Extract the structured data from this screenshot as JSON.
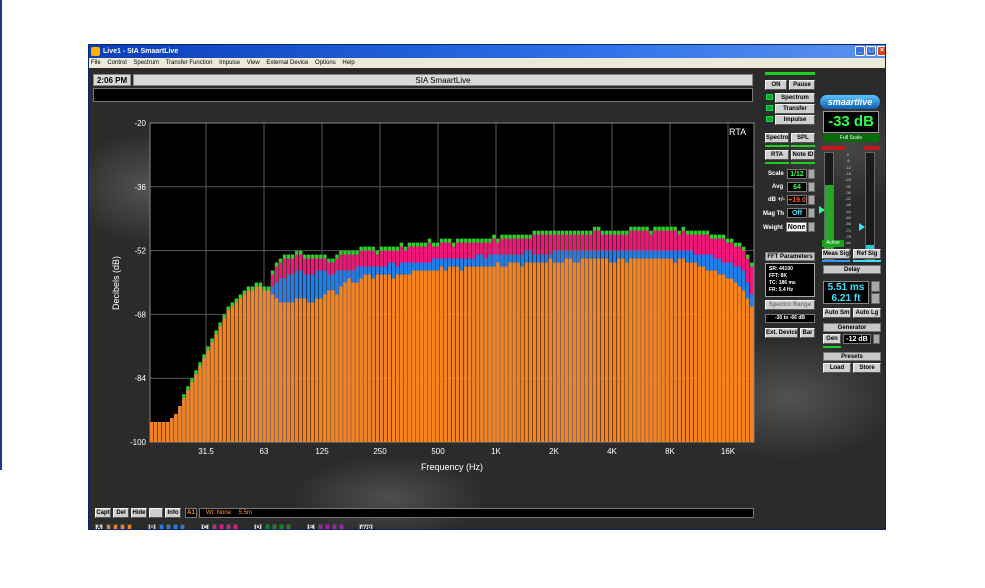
{
  "window": {
    "title": "Live1 - SIA SmaartLive"
  },
  "menu": [
    "File",
    "Control",
    "Spectrum",
    "Transfer Function",
    "Impulse",
    "View",
    "External Device",
    "Options",
    "Help"
  ],
  "header": {
    "clock": "2:06 PM",
    "app_title": "SIA SmaartLive"
  },
  "right_panel": {
    "on": "ON",
    "pause": "Pause",
    "mode_spectrum": "Spectrum",
    "mode_transfer": "Transfer",
    "mode_impulse": "Impulse",
    "spectro": "Spectro",
    "spl": "SPL",
    "rta": "RTA",
    "note_id": "Note ID",
    "scale_label": "Scale",
    "scale_value": "1/12",
    "avg_label": "Avg",
    "avg_value": "64",
    "db_label": "dB +/-",
    "db_value": "+19.0",
    "magth_label": "Mag Th",
    "magth_value": "Off",
    "weight_label": "Weight",
    "weight_value": "None",
    "fft_header": "FFT Parameters",
    "fft_sr": "SR: 44100",
    "fft_fft": "FFT: 8K",
    "fft_tc": "TC: 186 ms",
    "fft_fr": "FR: 5.4 Hz",
    "spectro_range": "Spectro Range",
    "spectro_range_value": "-30 to -66 dB",
    "ext_device": "Ext. Device",
    "bar": "Bar",
    "logo": "smaartlive",
    "level_readout": "-33 dB",
    "full_scale": "Full Scale",
    "active": "Active",
    "meas_sig": "Meas Sig",
    "ref_sig": "Ref Sig",
    "delay_header": "Delay",
    "delay_ms": "5.51 ms",
    "delay_ft": "6.21 ft",
    "auto_sm": "Auto Sm",
    "auto_lg": "Auto Lg",
    "generator_header": "Generator",
    "gen": "Gen",
    "gen_level": "-12 dB",
    "presets_header": "Presets",
    "load": "Load",
    "store": "Store",
    "meter_scale": [
      "0",
      "-6",
      "-12",
      "-18",
      "-24",
      "-30",
      "-36",
      "-42",
      "-48",
      "-54",
      "-60",
      "-66",
      "-72",
      "-78",
      "-84",
      "-90",
      "-96"
    ]
  },
  "bottom": {
    "capt": "Capt",
    "del": "Del",
    "hide": "Hide",
    "info": "Info",
    "status_a1": "A1",
    "status_wt": "Wt: None",
    "status_delay": "5.5m",
    "sets": [
      "A",
      "B",
      "C",
      "D",
      "E"
    ],
    "avg": "avg"
  },
  "colors": {
    "orange": "#f5841f",
    "blue": "#1f7fe8",
    "magenta": "#f0157a",
    "green": "#2bd12b"
  },
  "chart_data": {
    "type": "bar",
    "label": "RTA",
    "xlabel": "Frequency (Hz)",
    "ylabel": "Decibels (dB)",
    "ylim": [
      -100,
      -20
    ],
    "yticks": [
      "-20",
      "-36",
      "-52",
      "-68",
      "-84",
      "-100"
    ],
    "xticks": [
      "31.5",
      "63",
      "125",
      "250",
      "500",
      "1K",
      "2K",
      "4K",
      "8K",
      "16K"
    ],
    "grid": true,
    "bands": 150,
    "series": [
      {
        "name": "orange",
        "values": [
          -95,
          -95,
          -95,
          -95,
          -95,
          -94,
          -93,
          -91,
          -89,
          -87,
          -85,
          -83,
          -81,
          -79,
          -77,
          -75,
          -73,
          -71,
          -69,
          -67,
          -66,
          -65,
          -64,
          -63,
          -62,
          -62,
          -61,
          -61,
          -62,
          -62,
          -63,
          -64,
          -65,
          -65,
          -65,
          -65,
          -64,
          -64,
          -64,
          -65,
          -65,
          -64,
          -64,
          -63,
          -62,
          -62,
          -63,
          -61,
          -60,
          -59,
          -60,
          -60,
          -59,
          -58,
          -58,
          -59,
          -58,
          -58,
          -58,
          -58,
          -59,
          -58,
          -58,
          -58,
          -58,
          -57,
          -57,
          -57,
          -57,
          -57,
          -57,
          -57,
          -56,
          -57,
          -56,
          -56,
          -56,
          -57,
          -56,
          -56,
          -56,
          -56,
          -56,
          -56,
          -56,
          -56,
          -55,
          -56,
          -56,
          -55,
          -55,
          -55,
          -56,
          -55,
          -55,
          -55,
          -55,
          -55,
          -55,
          -54,
          -55,
          -55,
          -55,
          -54,
          -54,
          -55,
          -55,
          -54,
          -54,
          -54,
          -54,
          -54,
          -54,
          -54,
          -55,
          -55,
          -54,
          -54,
          -55,
          -54,
          -54,
          -54,
          -54,
          -54,
          -54,
          -54,
          -54,
          -54,
          -54,
          -54,
          -55,
          -54,
          -54,
          -55,
          -55,
          -55,
          -56,
          -56,
          -57,
          -57,
          -57,
          -58,
          -58,
          -59,
          -59,
          -60,
          -61,
          -62,
          -64,
          -66
        ]
      },
      {
        "name": "blue",
        "values": [
          -95,
          -95,
          -95,
          -95,
          -95,
          -94,
          -93,
          -91,
          -89,
          -87,
          -85,
          -83,
          -81,
          -79,
          -77,
          -75,
          -73,
          -71,
          -69,
          -67,
          -66,
          -65,
          -64,
          -63,
          -62,
          -62,
          -61,
          -61,
          -62,
          -62,
          -61,
          -60,
          -59,
          -59,
          -58,
          -58,
          -57,
          -57,
          -58,
          -58,
          -58,
          -57,
          -57,
          -57,
          -58,
          -58,
          -57,
          -57,
          -57,
          -57,
          -57,
          -56,
          -56,
          -56,
          -56,
          -56,
          -56,
          -56,
          -56,
          -55,
          -55,
          -56,
          -55,
          -55,
          -55,
          -55,
          -55,
          -55,
          -55,
          -55,
          -54,
          -54,
          -54,
          -54,
          -54,
          -54,
          -54,
          -54,
          -54,
          -54,
          -54,
          -53,
          -53,
          -54,
          -53,
          -53,
          -53,
          -53,
          -53,
          -53,
          -53,
          -53,
          -53,
          -52,
          -52,
          -53,
          -53,
          -53,
          -53,
          -53,
          -52,
          -52,
          -52,
          -52,
          -52,
          -52,
          -52,
          -52,
          -52,
          -52,
          -52,
          -52,
          -52,
          -52,
          -52,
          -52,
          -52,
          -52,
          -52,
          -52,
          -52,
          -52,
          -52,
          -52,
          -52,
          -52,
          -52,
          -52,
          -52,
          -52,
          -52,
          -52,
          -52,
          -52,
          -52,
          -53,
          -53,
          -53,
          -53,
          -53,
          -54,
          -54,
          -55,
          -55,
          -55,
          -56,
          -56,
          -57,
          -60,
          -63
        ]
      },
      {
        "name": "magenta",
        "values": [
          -95,
          -95,
          -95,
          -95,
          -95,
          -94,
          -93,
          -91,
          -89,
          -87,
          -85,
          -83,
          -81,
          -79,
          -77,
          -75,
          -73,
          -71,
          -69,
          -67,
          -66,
          -65,
          -64,
          -63,
          -62,
          -62,
          -61,
          -61,
          -62,
          -62,
          -58,
          -56,
          -55,
          -54,
          -54,
          -54,
          -53,
          -53,
          -54,
          -54,
          -54,
          -54,
          -54,
          -54,
          -55,
          -55,
          -54,
          -53,
          -53,
          -53,
          -53,
          -53,
          -52,
          -52,
          -52,
          -52,
          -53,
          -52,
          -52,
          -52,
          -52,
          -52,
          -51,
          -52,
          -51,
          -51,
          -51,
          -51,
          -51,
          -50,
          -51,
          -51,
          -50,
          -50,
          -50,
          -51,
          -50,
          -50,
          -50,
          -50,
          -50,
          -50,
          -50,
          -50,
          -50,
          -49,
          -50,
          -49,
          -49,
          -49,
          -49,
          -49,
          -49,
          -49,
          -49,
          -48,
          -48,
          -48,
          -48,
          -48,
          -48,
          -48,
          -48,
          -48,
          -48,
          -48,
          -48,
          -48,
          -48,
          -48,
          -47,
          -47,
          -48,
          -48,
          -48,
          -48,
          -48,
          -48,
          -48,
          -47,
          -47,
          -47,
          -47,
          -47,
          -48,
          -47,
          -47,
          -47,
          -47,
          -47,
          -47,
          -48,
          -47,
          -48,
          -48,
          -48,
          -48,
          -48,
          -48,
          -49,
          -49,
          -49,
          -49,
          -50,
          -50,
          -51,
          -51,
          -52,
          -54,
          -56
        ]
      },
      {
        "name": "green",
        "values": [
          -95,
          -95,
          -95,
          -95,
          -95,
          -94,
          -93,
          -91,
          -88,
          -86,
          -84,
          -82,
          -80,
          -78,
          -76,
          -74,
          -72,
          -70,
          -68,
          -66,
          -65,
          -64,
          -63,
          -62,
          -61,
          -61,
          -60,
          -60,
          -61,
          -61,
          -57,
          -55,
          -54,
          -53,
          -53,
          -53,
          -52,
          -52,
          -53,
          -53,
          -53,
          -53,
          -53,
          -53,
          -54,
          -54,
          -53,
          -52,
          -52,
          -52,
          -52,
          -52,
          -51,
          -51,
          -51,
          -51,
          -52,
          -51,
          -51,
          -51,
          -51,
          -51,
          -50,
          -51,
          -50,
          -50,
          -50,
          -50,
          -50,
          -49,
          -50,
          -50,
          -49,
          -49,
          -49,
          -50,
          -49,
          -49,
          -49,
          -49,
          -49,
          -49,
          -49,
          -49,
          -49,
          -48,
          -49,
          -48,
          -48,
          -48,
          -48,
          -48,
          -48,
          -48,
          -48,
          -47,
          -47,
          -47,
          -47,
          -47,
          -47,
          -47,
          -47,
          -47,
          -47,
          -47,
          -47,
          -47,
          -47,
          -47,
          -46,
          -46,
          -47,
          -47,
          -47,
          -47,
          -47,
          -47,
          -47,
          -46,
          -46,
          -46,
          -46,
          -46,
          -47,
          -46,
          -46,
          -46,
          -46,
          -46,
          -46,
          -47,
          -46,
          -47,
          -47,
          -47,
          -47,
          -47,
          -47,
          -48,
          -48,
          -48,
          -48,
          -49,
          -49,
          -50,
          -50,
          -51,
          -53,
          -55
        ]
      }
    ]
  }
}
